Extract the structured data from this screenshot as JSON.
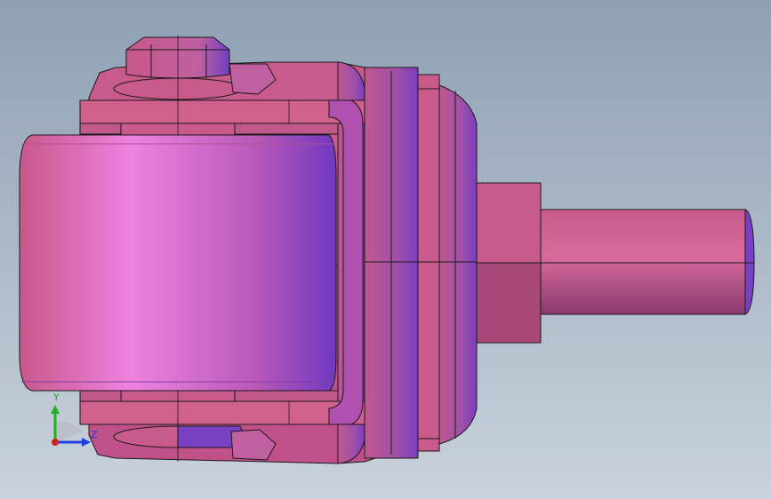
{
  "viewport": {
    "background_top": "#8fa0b4",
    "background_bottom": "#c9d2dc"
  },
  "model": {
    "part_color": "#d0608c",
    "highlight_color": "#ee82e0",
    "shadow_color": "#7a3ec0",
    "edge_color": "#1a1a1a"
  },
  "triad": {
    "x_label": "",
    "y_label": "Y",
    "z_label": "Z",
    "x_color": "#d02020",
    "y_color": "#20b020",
    "z_color": "#2040e0"
  }
}
